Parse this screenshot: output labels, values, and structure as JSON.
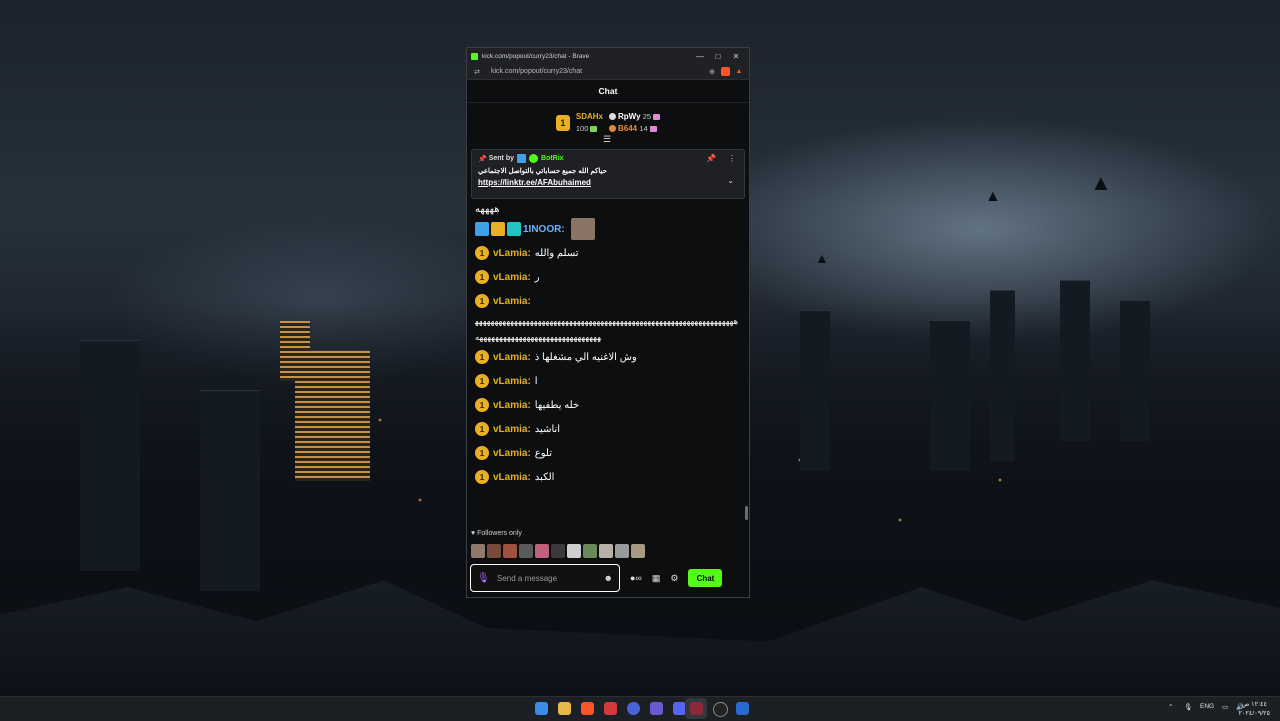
{
  "browser": {
    "window_title": "kick.com/popout/curry23/chat - Brave",
    "url": "kick.com/popout/curry23/chat",
    "controls": {
      "minimize": "—",
      "maximize": "□",
      "close": "✕"
    }
  },
  "chat": {
    "header": "Chat",
    "leaderboard": {
      "first": {
        "rank": "1",
        "name": "SDAHx",
        "count": "100"
      },
      "second": {
        "name": "RpWy",
        "count": "25"
      },
      "third": {
        "name": "B644",
        "count": "14"
      }
    },
    "pinned": {
      "sent_by_label": "Sent by",
      "bot_name": "BotRix",
      "message": "حياكم الله جميع حساباتي بالتواصل الاجتماعي",
      "link": "https://linktr.ee/AFAbuhaimed"
    },
    "messages": [
      {
        "type": "fragment",
        "text": "ههههه"
      },
      {
        "user": "1INOOR:",
        "text": "",
        "badges": [
          "moderator-icon",
          "crown-icon",
          "og-icon"
        ]
      },
      {
        "user": "vLamia:",
        "text": "تسلم والله"
      },
      {
        "user": "vLamia:",
        "text": "ر"
      },
      {
        "user": "vLamia:",
        "text": ""
      },
      {
        "type": "long",
        "text": "ههههههههههههههههههههههههههههههههههههههههههههههههههههههههههههههههههههههههههههههههههههههههههههههههههه"
      },
      {
        "user": "vLamia:",
        "text": "وش الاغنيه الي مشغلها ذ"
      },
      {
        "user": "vLamia:",
        "text": "ا"
      },
      {
        "user": "vLamia:",
        "text": "خله يطفيها"
      },
      {
        "user": "vLamia:",
        "text": "اناشيد"
      },
      {
        "user": "vLamia:",
        "text": "تلوع"
      },
      {
        "user": "vLamia:",
        "text": "الكبد"
      }
    ],
    "followers_only": "Followers only",
    "input": {
      "placeholder": "Send a message"
    },
    "send_label": "Chat"
  },
  "taskbar": {
    "language": "ENG",
    "time": "١٢:٤٤ ص",
    "date": "٢٠٢٤/٠٩/٢٥"
  },
  "colors": {
    "kick_green": "#53fc18",
    "gold": "#e8b022",
    "brave": "#fb542b"
  }
}
